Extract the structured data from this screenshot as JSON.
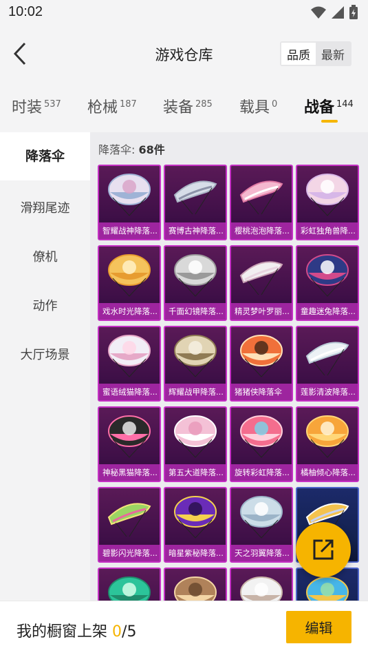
{
  "status_bar": {
    "time": "10:02"
  },
  "header": {
    "title": "游戏仓库",
    "sort_options": [
      "品质",
      "最新"
    ],
    "sort_selected": "品质"
  },
  "tabs": [
    {
      "label": "时装",
      "count": "537"
    },
    {
      "label": "枪械",
      "count": "187"
    },
    {
      "label": "装备",
      "count": "285"
    },
    {
      "label": "载具",
      "count": "0"
    },
    {
      "label": "战备",
      "count": "144"
    }
  ],
  "active_tab": "战备",
  "sidebar": {
    "items": [
      "降落伞",
      "滑翔尾迹",
      "僚机",
      "动作",
      "大厅场景"
    ],
    "active": "降落伞"
  },
  "content": {
    "count_prefix": "降落伞: ",
    "count_value": "68件",
    "items": [
      {
        "name": "智耀战神降落...",
        "icon": "parachute-ornate-white"
      },
      {
        "name": "赛博古神降落...",
        "icon": "parachute-glider-silver"
      },
      {
        "name": "樱桃泡泡降落...",
        "icon": "parachute-glider-pink"
      },
      {
        "name": "彩虹独角兽降...",
        "icon": "parachute-dome-pastel"
      },
      {
        "name": "戏水时光降落...",
        "icon": "parachute-dome-gold-cat"
      },
      {
        "name": "千面幻镜降落...",
        "icon": "parachute-diamond-silver"
      },
      {
        "name": "精灵梦叶罗丽...",
        "icon": "parachute-glider-white"
      },
      {
        "name": "童趣迷兔降落...",
        "icon": "parachute-bow-navy"
      },
      {
        "name": "蜜语绒猫降落...",
        "icon": "parachute-cat-face"
      },
      {
        "name": "辉耀战甲降落...",
        "icon": "parachute-armor-gold"
      },
      {
        "name": "猪猪侠降落伞",
        "icon": "parachute-face-red"
      },
      {
        "name": "莲影清波降落...",
        "icon": "parachute-glider-pearl"
      },
      {
        "name": "神秘黑猫降落...",
        "icon": "parachute-black-cat"
      },
      {
        "name": "第五大道降落...",
        "icon": "parachute-dome-pink-plaid"
      },
      {
        "name": "旋转彩虹降落...",
        "icon": "parachute-dome-rainbow"
      },
      {
        "name": "橘柚倾心降落...",
        "icon": "parachute-orange-flower"
      },
      {
        "name": "碧影闪光降落...",
        "icon": "parachute-glider-green"
      },
      {
        "name": "暗星紫秘降落...",
        "icon": "parachute-dome-purple-star"
      },
      {
        "name": "天之羽翼降落...",
        "icon": "parachute-dome-sky"
      },
      {
        "name": "",
        "icon": "parachute-wing-gold"
      },
      {
        "name": "",
        "icon": "parachute-green-partial"
      },
      {
        "name": "",
        "icon": "parachute-brown-partial"
      },
      {
        "name": "",
        "icon": "parachute-white-partial"
      },
      {
        "name": "",
        "icon": "parachute-blue-partial"
      }
    ]
  },
  "fab": {
    "icon": "share-external-icon"
  },
  "bottom": {
    "label": "我的橱窗上架",
    "current": "0",
    "separator": "/",
    "max": "5",
    "edit_label": "编辑"
  },
  "colors": {
    "accent": "#f6b400",
    "card_border": "#c42fc4",
    "card_bg": "#4a1450",
    "card_label_bg": "#aa28aa"
  }
}
